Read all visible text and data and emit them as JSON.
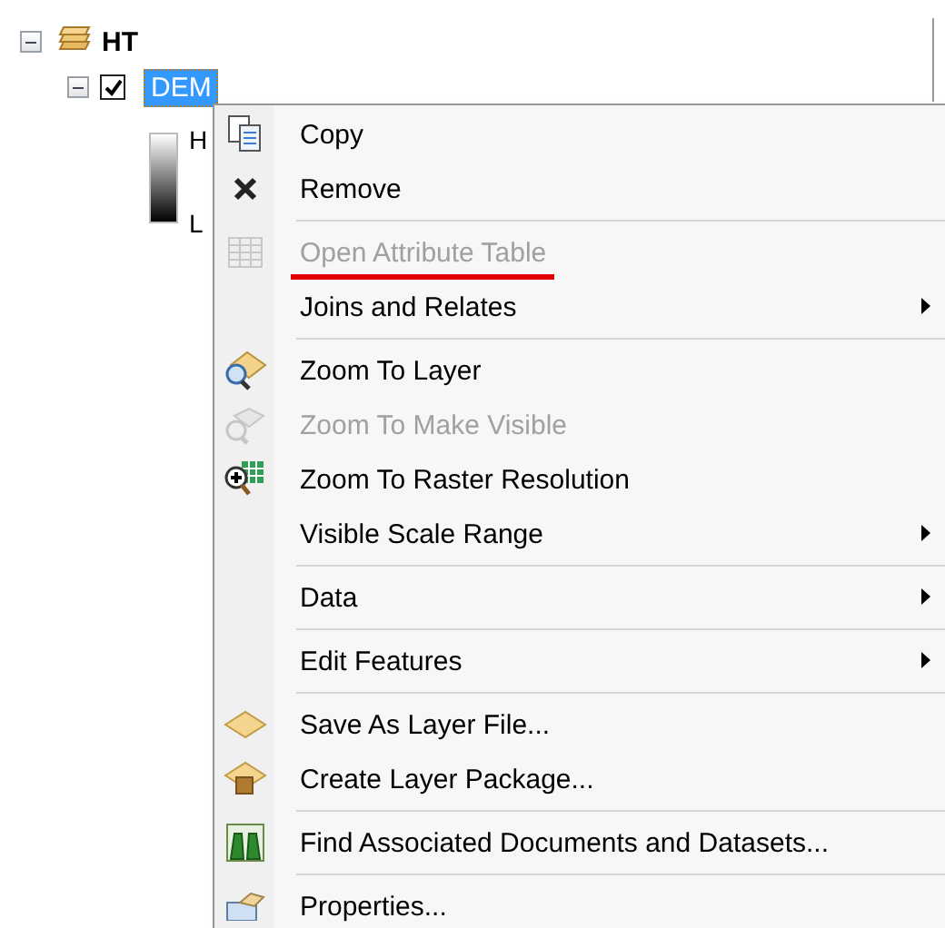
{
  "tree": {
    "group": {
      "label": "HT",
      "expanded": true
    },
    "layer": {
      "label": "DEM",
      "checked": true,
      "selected": true,
      "expanded": true,
      "legend": {
        "high": "H",
        "low": "L"
      }
    }
  },
  "context_menu": {
    "groups": [
      [
        {
          "label": "Copy",
          "disabled": false,
          "submenu": false,
          "underlined": false
        },
        {
          "label": "Remove",
          "disabled": false,
          "submenu": false,
          "underlined": false
        }
      ],
      [
        {
          "label": "Open Attribute Table",
          "disabled": true,
          "submenu": false,
          "underlined": true
        },
        {
          "label": "Joins and Relates",
          "disabled": false,
          "submenu": true,
          "underlined": false
        }
      ],
      [
        {
          "label": "Zoom To Layer",
          "disabled": false,
          "submenu": false,
          "underlined": false
        },
        {
          "label": "Zoom To Make Visible",
          "disabled": true,
          "submenu": false,
          "underlined": false
        },
        {
          "label": "Zoom To Raster Resolution",
          "disabled": false,
          "submenu": false,
          "underlined": false
        },
        {
          "label": "Visible Scale Range",
          "disabled": false,
          "submenu": true,
          "underlined": false
        }
      ],
      [
        {
          "label": "Data",
          "disabled": false,
          "submenu": true,
          "underlined": false
        }
      ],
      [
        {
          "label": "Edit Features",
          "disabled": false,
          "submenu": true,
          "underlined": false
        }
      ],
      [
        {
          "label": "Save As Layer File...",
          "disabled": false,
          "submenu": false,
          "underlined": false
        },
        {
          "label": "Create Layer Package...",
          "disabled": false,
          "submenu": false,
          "underlined": false
        }
      ],
      [
        {
          "label": "Find Associated Documents and Datasets...",
          "disabled": false,
          "submenu": false,
          "underlined": false
        }
      ],
      [
        {
          "label": "Properties...",
          "disabled": false,
          "submenu": false,
          "underlined": false
        }
      ]
    ]
  }
}
